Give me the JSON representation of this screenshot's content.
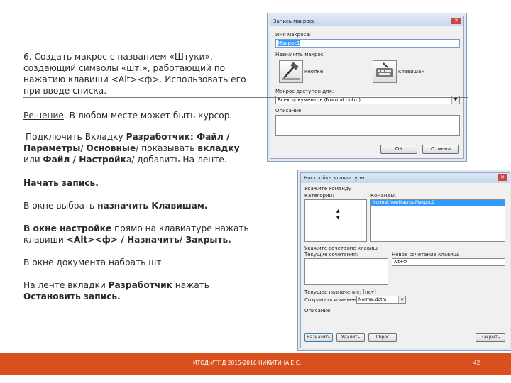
{
  "slide": {
    "p1": "6. Создать макрос с названием «Штуки», создающий символы «шт.», работающий по нажатию клавиши <Alt><ф>. Использовать его при вводе списка.",
    "p2_a": "Решение",
    "p2_b": ". В любом месте может быть курсор.",
    "p3_a": "Подключить Вкладку ",
    "p3_b": "Разработчик: Файл / Параметры",
    "p3_c": "/ ",
    "p3_d": "Основные",
    "p3_e": "/ показывать ",
    "p3_f": "вкладку",
    "p3_g": " или ",
    "p3_h": "Файл / Настройк",
    "p3_i": "а/ добавить На ленте.",
    "p4": "Начать запись.",
    "p5_a": "В окне выбрать ",
    "p5_b": "назначить Клавишам.",
    "p6_a": "В окне настройке",
    "p6_b": " прямо на клавиатуре нажать клавиши ",
    "p6_c": "<Alt><ф> / Назначить/ Закрыть.",
    "p7": "В окне документа набрать шт.",
    "p8_a": "На ленте вкладки ",
    "p8_b": "Разработчик",
    "p8_c": " нажать ",
    "p8_d": "Остановить запись."
  },
  "dialog1": {
    "title": "Запись макроса",
    "name_label": "Имя макроса:",
    "name_value": "Макрос1",
    "assign_label": "Назначить макрос",
    "btn_buttons": "кнопке",
    "btn_keyboard": "клавишам",
    "store_label": "Макрос доступен для:",
    "store_value": "Всех документов (Normal.dotm)",
    "desc_label": "Описание:",
    "ok": "ОК",
    "cancel": "Отмена"
  },
  "dialog2": {
    "title": "Настройка клавиатуры",
    "cmd_label": "Укажите команду",
    "categories_label": "Категории:",
    "commands_label": "Команды:",
    "command_item": "Normal.NewMacros.Макрос1",
    "keys_label": "Укажите сочетание клавиш",
    "current_keys_label": "Текущие сочетания:",
    "new_key_label": "Новое сочетание клавиш:",
    "new_key_value": "Alt+Ф",
    "assigned_label": "Текущее назначение: [нет]",
    "save_label": "Сохранить изменения в:",
    "save_value": "Normal.dotm",
    "desc_label": "Описание",
    "assign": "Назначить",
    "remove": "Удалить",
    "reset": "Сброс",
    "close": "Закрыть"
  },
  "footer": {
    "text": "ИТОД-ИТПД 2015-2016   НИКИТИНА Е.С.",
    "page": "42"
  }
}
